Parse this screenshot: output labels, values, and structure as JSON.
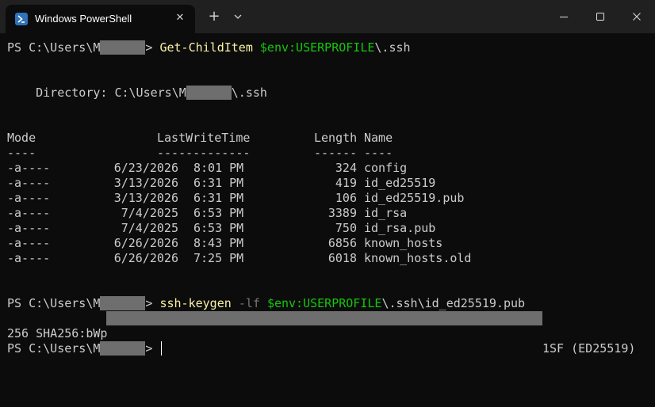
{
  "window": {
    "tab_title": "Windows PowerShell",
    "tab_close_glyph": "✕",
    "new_tab_glyph": "+",
    "icons": {
      "tab": "powershell-icon",
      "dropdown": "chevron-down-icon",
      "minimize": "minimize-icon",
      "maximize": "maximize-icon",
      "close": "close-icon"
    }
  },
  "colors": {
    "background": "#0c0c0c",
    "titlebar": "#202020",
    "text": "#cccccc",
    "command": "#f9f1a5",
    "variable": "#16c60c",
    "parameter": "#767676",
    "redaction": "#6e6e6e"
  },
  "terminal": {
    "cmd1": {
      "prompt": "PS C:\\Users\\M",
      "gt": ">",
      "command": "Get-ChildItem",
      "variable": "$env:USERPROFILE",
      "arg": "\\.ssh"
    },
    "directory": {
      "label": "    Directory: C:\\Users\\M",
      "suffix": "\\.ssh"
    },
    "headers": {
      "mode": "Mode",
      "lastwrite": "LastWriteTime",
      "length": "Length",
      "name": "Name"
    },
    "underlines": {
      "mode": "----",
      "lastwrite": "-------------",
      "length": "------",
      "name": "----"
    },
    "rows": [
      {
        "mode": "-a----",
        "date": "6/23/2026",
        "time": "8:01 PM",
        "length": "324",
        "name": "config"
      },
      {
        "mode": "-a----",
        "date": "3/13/2026",
        "time": "6:31 PM",
        "length": "419",
        "name": "id_ed25519"
      },
      {
        "mode": "-a----",
        "date": "3/13/2026",
        "time": "6:31 PM",
        "length": "106",
        "name": "id_ed25519.pub"
      },
      {
        "mode": "-a----",
        "date": "7/4/2025",
        "time": "6:53 PM",
        "length": "3389",
        "name": "id_rsa"
      },
      {
        "mode": "-a----",
        "date": "7/4/2025",
        "time": "6:53 PM",
        "length": "750",
        "name": "id_rsa.pub"
      },
      {
        "mode": "-a----",
        "date": "6/26/2026",
        "time": "8:43 PM",
        "length": "6856",
        "name": "known_hosts"
      },
      {
        "mode": "-a----",
        "date": "6/26/2026",
        "time": "7:25 PM",
        "length": "6018",
        "name": "known_hosts.old"
      }
    ],
    "cmd2": {
      "prompt": "PS C:\\Users\\M",
      "gt": ">",
      "command": "ssh-keygen",
      "param": "-lf",
      "variable": "$env:USERPROFILE",
      "arg": "\\.ssh\\id_ed25519.pub"
    },
    "fingerprint": {
      "prefix": "256 SHA256:bWp",
      "suffix": "1SF (ED25519)"
    },
    "cmd3": {
      "prompt": "PS C:\\Users\\M",
      "gt": ">"
    }
  }
}
